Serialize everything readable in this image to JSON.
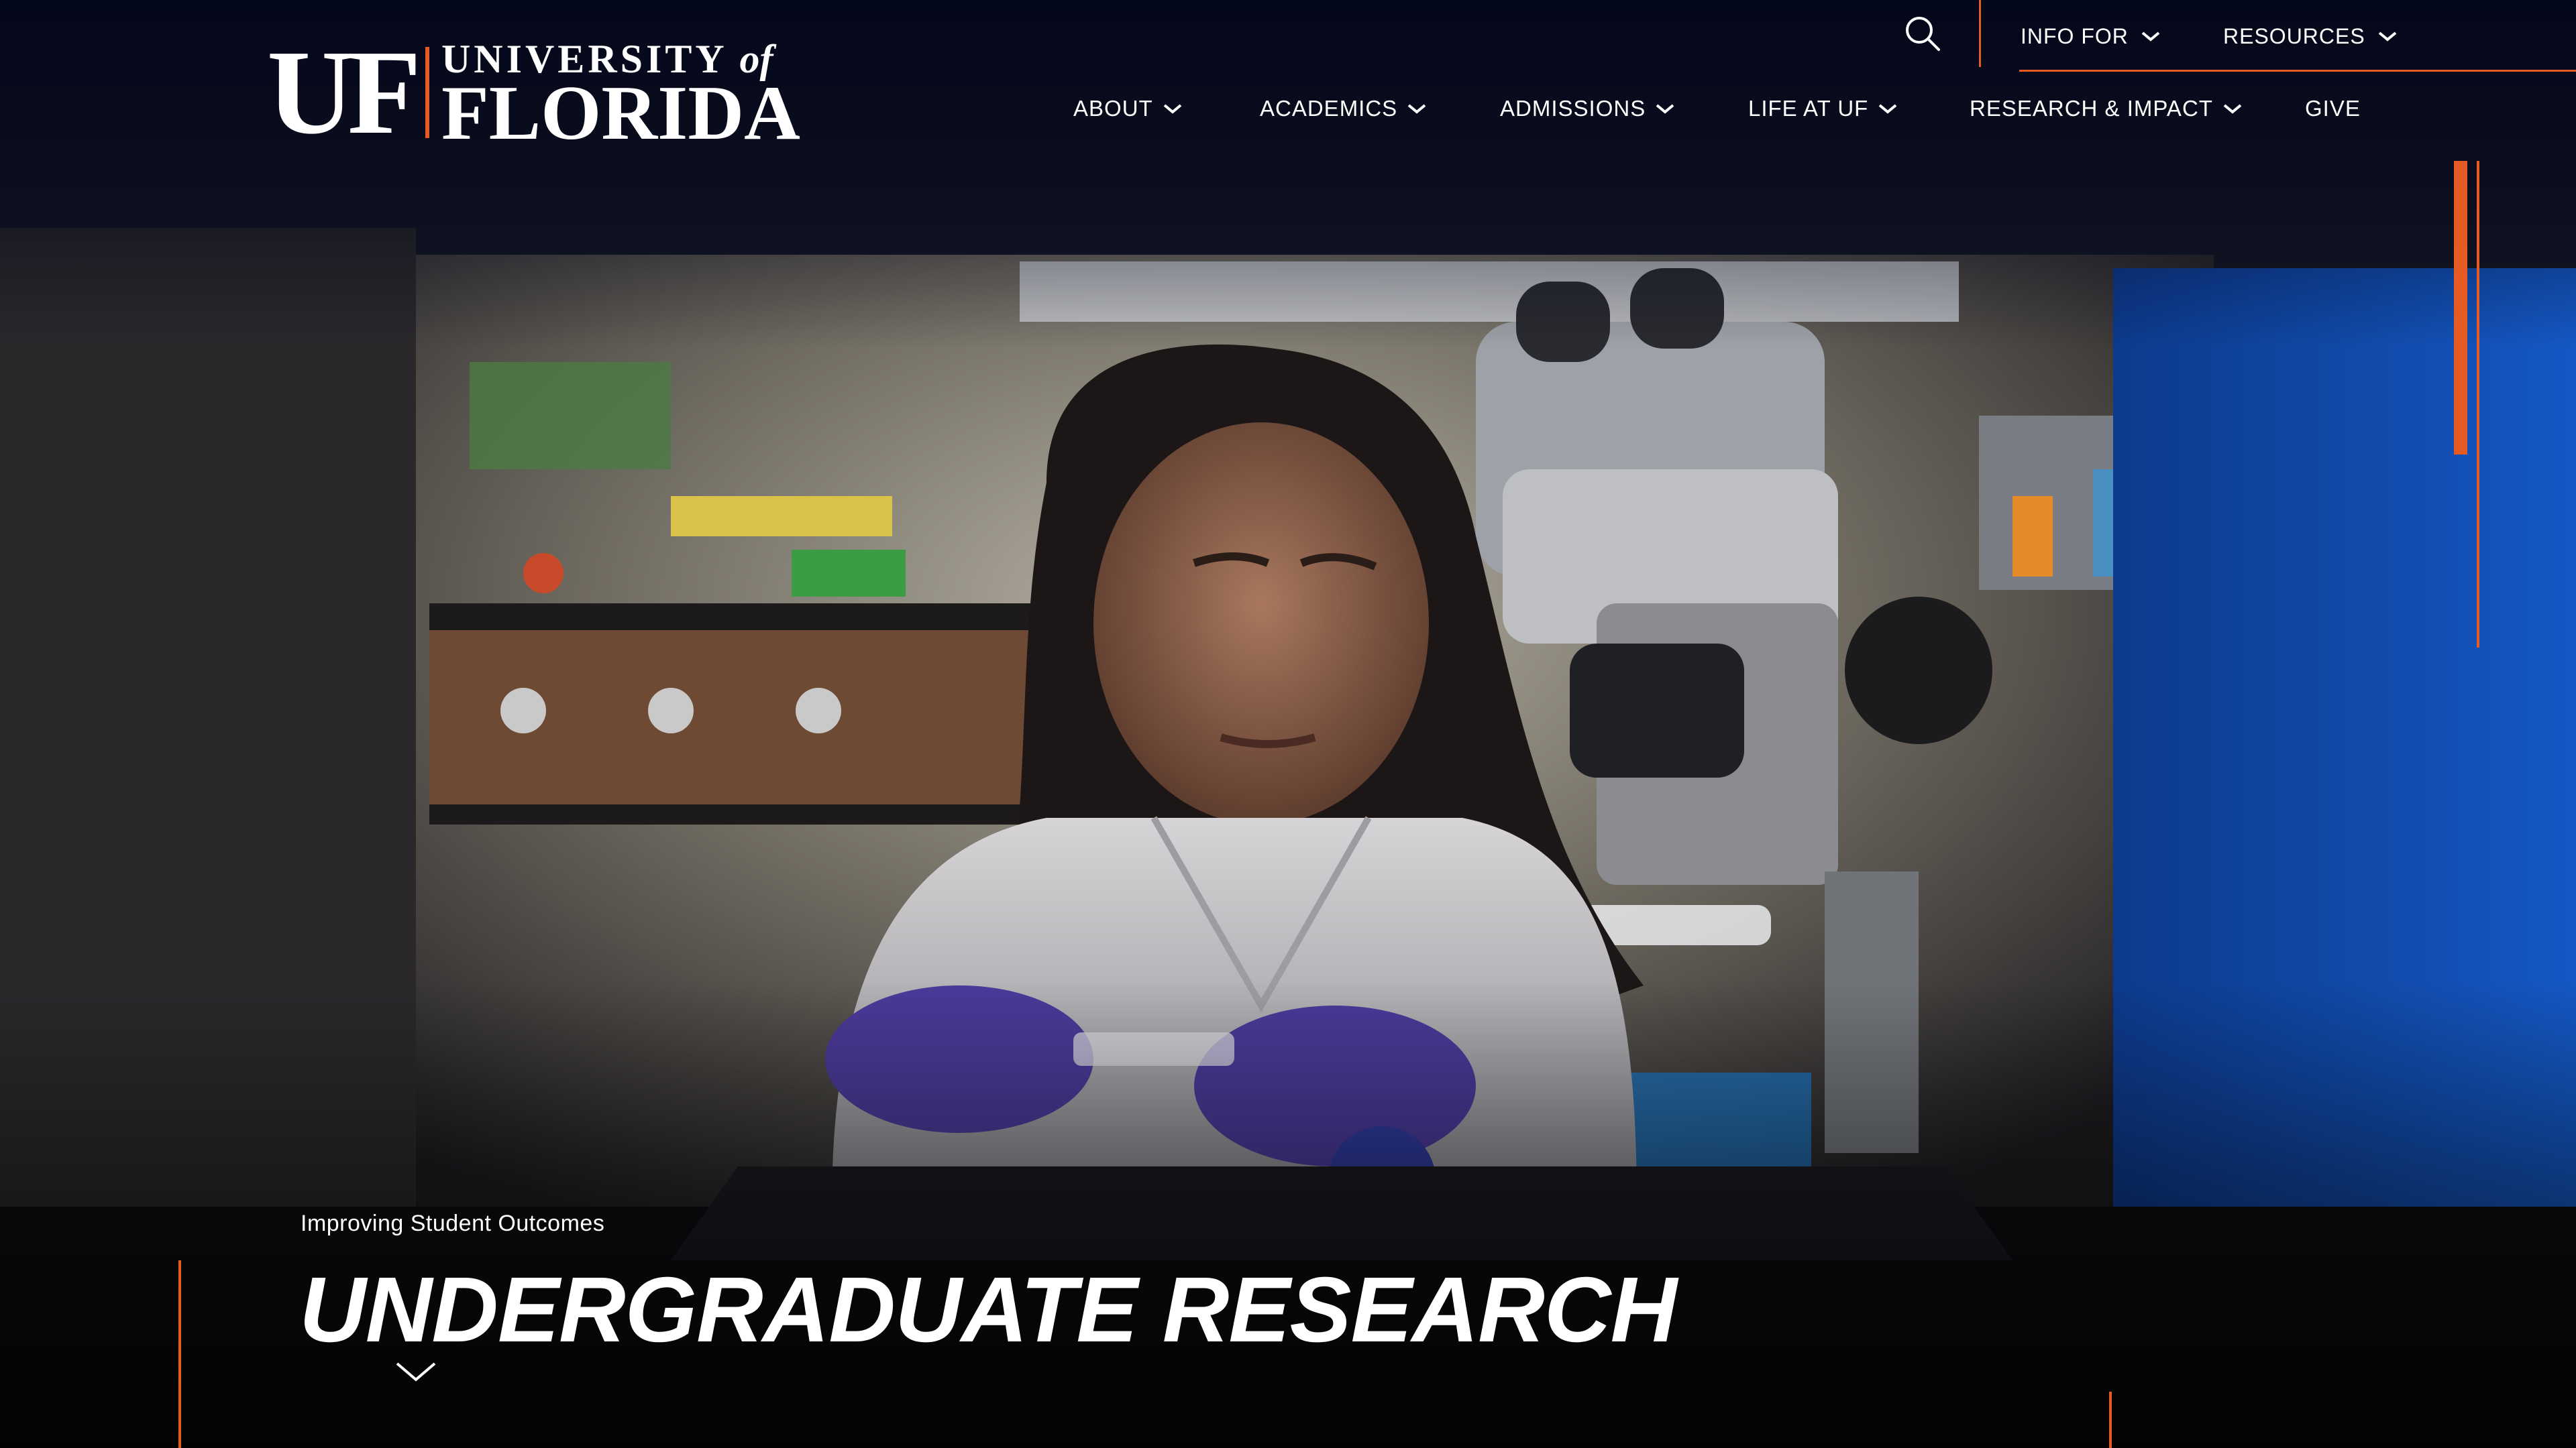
{
  "site": {
    "logo": {
      "initials": "UF",
      "line1": "UNIVERSITY",
      "line1_suffix": "of",
      "line2": "FLORIDA"
    }
  },
  "utility_nav": {
    "search_icon": "search-icon",
    "items": [
      {
        "label": "INFO FOR",
        "icon": "chevron-down-icon"
      },
      {
        "label": "RESOURCES",
        "icon": "chevron-down-icon"
      }
    ]
  },
  "main_nav": {
    "items": [
      {
        "label": "ABOUT",
        "has_dropdown": true
      },
      {
        "label": "ACADEMICS",
        "has_dropdown": true
      },
      {
        "label": "ADMISSIONS",
        "has_dropdown": true
      },
      {
        "label": "LIFE AT UF",
        "has_dropdown": true
      },
      {
        "label": "RESEARCH & IMPACT",
        "has_dropdown": true
      },
      {
        "label": "GIVE",
        "has_dropdown": false
      }
    ]
  },
  "hero": {
    "eyebrow": "Improving Student Outcomes",
    "title": "UNDERGRADUATE RESEARCH",
    "scroll_icon": "chevron-down-icon"
  },
  "colors": {
    "accent": "#e65a23",
    "header_bg": "#03061a",
    "text": "#ffffff"
  }
}
